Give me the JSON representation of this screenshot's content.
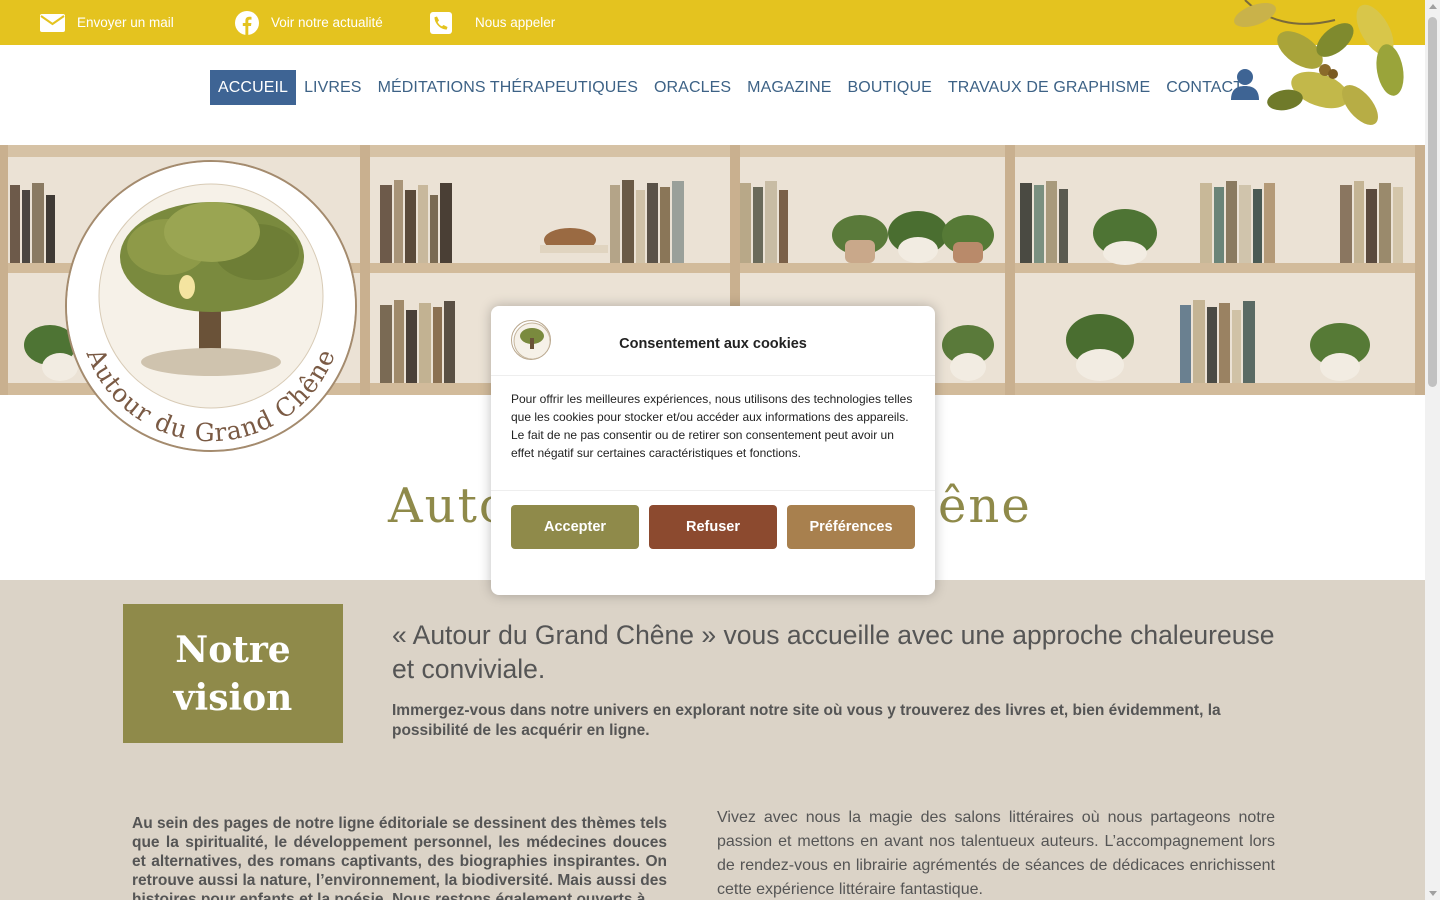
{
  "topbar": {
    "mail_label": "Envoyer un mail",
    "facebook_label": "Voir notre actualité",
    "phone_label": "Nous appeler"
  },
  "nav": {
    "items": [
      "ACCUEIL",
      "LIVRES",
      "MÉDITATIONS THÉRAPEUTIQUES",
      "ORACLES",
      "MAGAZINE",
      "BOUTIQUE",
      "TRAVAUX DE GRAPHISME",
      "CONTACT"
    ],
    "active": "ACCUEIL"
  },
  "logo": {
    "text": "Autour du Grand Chêne"
  },
  "hero_title": {
    "visible_left": "Auto",
    "visible_right": "êne"
  },
  "vision": {
    "box_label": "Notre vision",
    "headline": "« Autour du Grand Chêne » vous accueille avec une approche chaleureuse et conviviale.",
    "subhead": "Immergez-vous dans notre univers en explorant notre site où vous y trouverez des livres et, bien évidemment, la possibilité de les acquérir en ligne."
  },
  "columns": {
    "left": "Au sein des pages de notre ligne éditoriale se dessinent des thèmes tels que la spiritualité, le développement personnel, les médecines douces et alternatives, des romans captivants, des biographies inspirantes. On retrouve aussi la nature, l’environnement, la biodiversité. Mais aussi des histoires pour enfants et la poésie. Nous restons également ouverts à",
    "right": "Vivez avec nous la magie des salons littéraires où nous partageons notre passion et mettons en avant nos talentueux auteurs. L’accompagnement lors de rendez-vous en librairie agrémentés de séances de dédicaces enrichissent cette expérience littéraire fantastique."
  },
  "cookie_modal": {
    "title": "Consentement aux cookies",
    "body": "Pour offrir les meilleures expériences, nous utilisons des technologies telles que les cookies pour stocker et/ou accéder aux informations des appareils. Le fait de ne pas consentir ou de retirer son consentement peut avoir un effet négatif sur certaines caractéristiques et fonctions.",
    "accept_label": "Accepter",
    "refuse_label": "Refuser",
    "prefs_label": "Préférences"
  },
  "colors": {
    "topbar": "#e4c31f",
    "nav_text": "#3d6286",
    "nav_active_bg": "#3e6494",
    "olive": "#8f8a4a",
    "beige": "#dbd3c7",
    "refuse": "#8c4a2f",
    "prefs": "#a8804e"
  },
  "icons": [
    "envelope-icon",
    "facebook-icon",
    "phone-icon",
    "user-icon",
    "oak-leaves-decoration"
  ]
}
